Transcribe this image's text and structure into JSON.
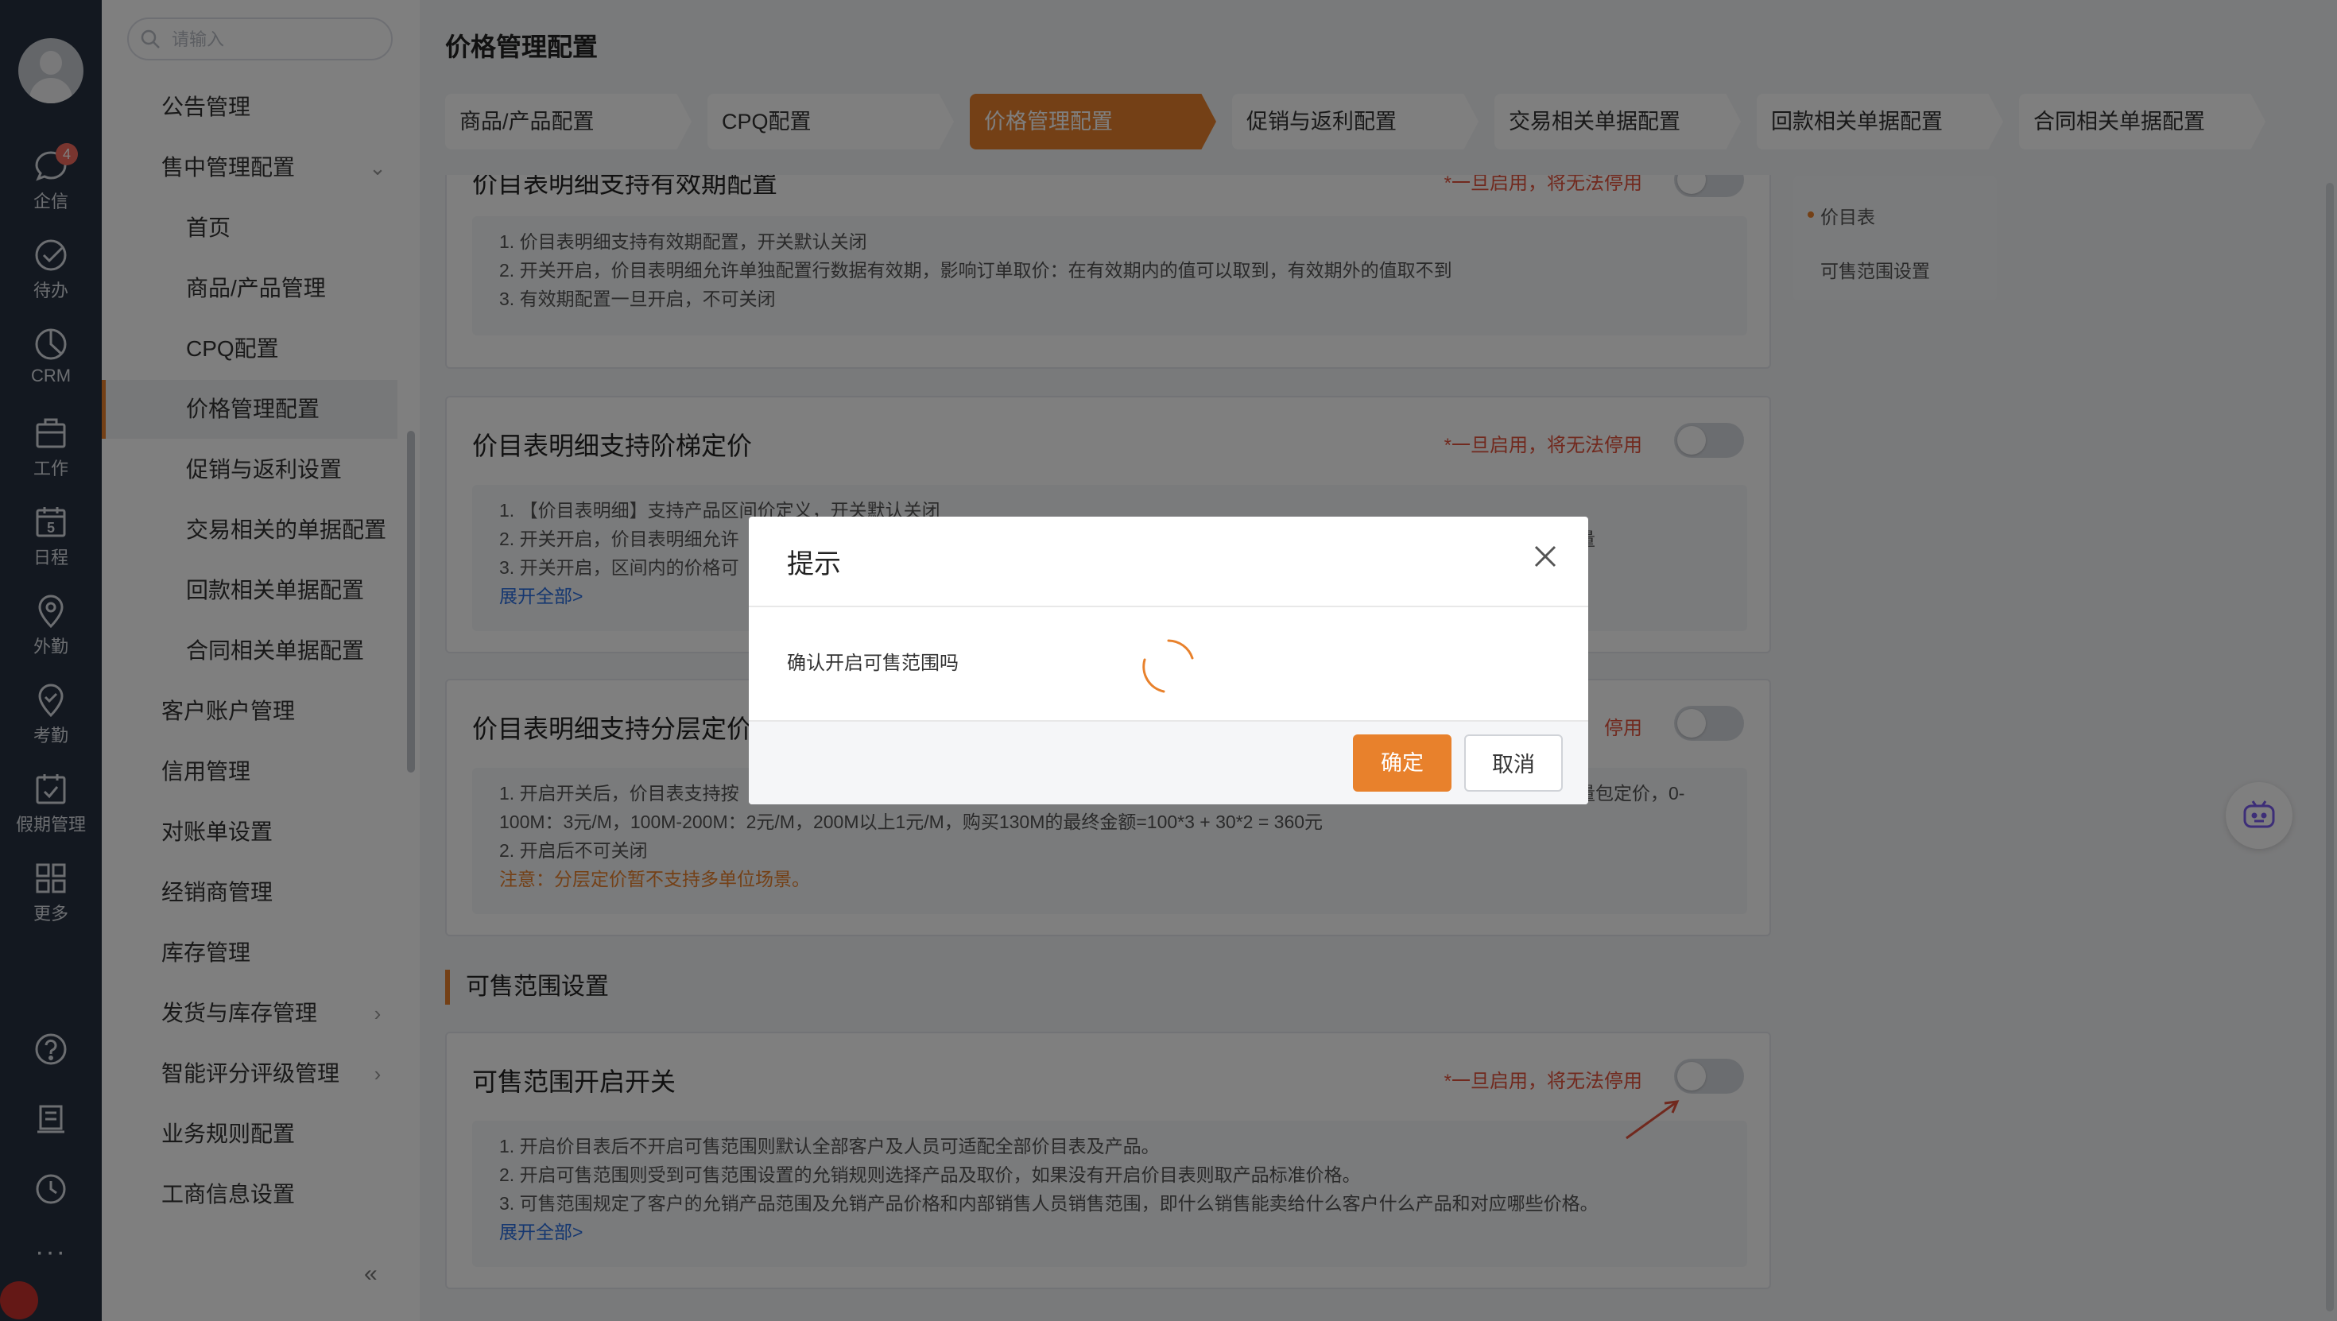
{
  "rail": {
    "items": [
      {
        "label": "企信",
        "icon": "chat-icon",
        "badge": "4"
      },
      {
        "label": "待办",
        "icon": "check-circle-icon"
      },
      {
        "label": "CRM",
        "icon": "pie-clock-icon"
      },
      {
        "label": "工作",
        "icon": "briefcase-icon"
      },
      {
        "label": "日程",
        "icon": "calendar-icon",
        "day": "5"
      },
      {
        "label": "外勤",
        "icon": "location-pin-icon"
      },
      {
        "label": "考勤",
        "icon": "badge-check-icon"
      },
      {
        "label": "假期管理",
        "icon": "calendar-check-icon"
      },
      {
        "label": "更多",
        "icon": "grid-icon"
      }
    ],
    "bottom": [
      "help-icon",
      "notes-icon",
      "history-icon"
    ],
    "more": "···"
  },
  "menu": {
    "search_placeholder": "请输入",
    "items": [
      {
        "label": "公告管理",
        "level": 1
      },
      {
        "label": "售中管理配置",
        "level": 1
      },
      {
        "label": "首页",
        "level": 2
      },
      {
        "label": "商品/产品管理",
        "level": 2
      },
      {
        "label": "CPQ配置",
        "level": 2
      },
      {
        "label": "价格管理配置",
        "level": 2,
        "active": true
      },
      {
        "label": "促销与返利设置",
        "level": 2
      },
      {
        "label": "交易相关的单据配置",
        "level": 2
      },
      {
        "label": "回款相关单据配置",
        "level": 2
      },
      {
        "label": "合同相关单据配置",
        "level": 2
      },
      {
        "label": "客户账户管理",
        "level": 1
      },
      {
        "label": "信用管理",
        "level": 1
      },
      {
        "label": "对账单设置",
        "level": 1
      },
      {
        "label": "经销商管理",
        "level": 1
      },
      {
        "label": "库存管理",
        "level": 1
      },
      {
        "label": "发货与库存管理",
        "level": 1
      },
      {
        "label": "智能评分评级管理",
        "level": 1
      },
      {
        "label": "业务规则配置",
        "level": 1
      },
      {
        "label": "工商信息设置",
        "level": 1
      }
    ],
    "collapse": "«"
  },
  "page": {
    "title": "价格管理配置",
    "tabs": [
      "商品/产品配置",
      "CPQ配置",
      "价格管理配置",
      "促销与返利配置",
      "交易相关单据配置",
      "回款相关单据配置",
      "合同相关单据配置"
    ],
    "active_tab": 2
  },
  "cards": {
    "validity": {
      "title": "价目表明细支持有效期配置",
      "warn": "*一旦启用，将无法停用",
      "lines": [
        "1. 价目表明细支持有效期配置，开关默认关闭",
        "2. 开关开启，价目表明细允许单独配置行数据有效期，影响订单取价：在有效期内的值可以取到，有效期外的值取不到",
        "3. 有效期配置一旦开启，不可关闭"
      ]
    },
    "ladder": {
      "title": "价目表明细支持阶梯定价",
      "warn": "*一旦启用，将无法停用",
      "lines": [
        "1. 【价目表明细】支持产品区间价定义，开关默认关闭",
        "2. 开关开启，价目表明细允许",
        "3. 开关开启，区间内的价格可"
      ],
      "line2_tail": "量",
      "more": "展开全部>"
    },
    "tier": {
      "title": "价目表明细支持分层定价",
      "warn": "停用",
      "lines": [
        "1. 开启开关后，价目表支持按",
        "100M：3元/M，100M-200M：2元/M，200M以上1元/M，购买130M的最终金额=100*3 + 30*2 = 360元",
        "2. 开启后不可关闭"
      ],
      "line1_tail": "量包定价，0-",
      "note": "注意：分层定价暂不支持多单位场景。"
    },
    "section_title": "可售范围设置",
    "sale": {
      "title": "可售范围开启开关",
      "warn": "*一旦启用，将无法停用",
      "lines": [
        "1. 开启价目表后不开启可售范围则默认全部客户及人员可适配全部价目表及产品。",
        "2. 开启可售范围则受到可售范围设置的允销规则选择产品及取价，如果没有开启价目表则取产品标准价格。",
        "3. 可售范围规定了客户的允销产品范围及允销产品价格和内部销售人员销售范围，即什么销售能卖给什么客户什么产品和对应哪些价格。"
      ],
      "more": "展开全部>"
    }
  },
  "anchors": [
    "价目表",
    "可售范围设置"
  ],
  "modal": {
    "title": "提示",
    "message": "确认开启可售范围吗",
    "ok": "确定",
    "cancel": "取消"
  },
  "colors": {
    "accent": "#e8812c",
    "warn": "#e2533d",
    "link": "#2b6ee0",
    "rail": "#263041"
  }
}
